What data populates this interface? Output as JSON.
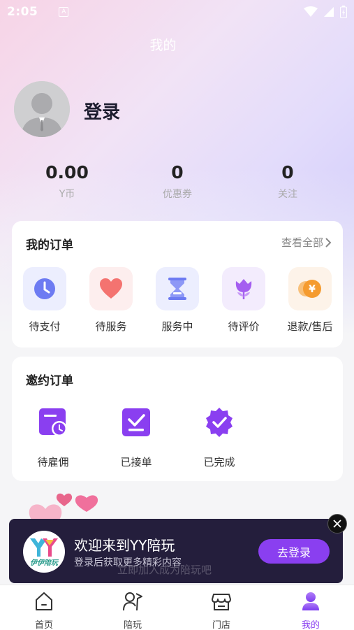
{
  "status_bar": {
    "time": "2:05",
    "a_label": "A"
  },
  "header": {
    "title": "我的"
  },
  "profile": {
    "login_label": "登录"
  },
  "stats": [
    {
      "value": "0.00",
      "label": "Y币"
    },
    {
      "value": "0",
      "label": "优惠券"
    },
    {
      "value": "0",
      "label": "关注"
    }
  ],
  "my_orders": {
    "title": "我的订单",
    "view_all": "查看全部",
    "items": [
      {
        "label": "待支付",
        "icon": "clock-icon",
        "tile_color": "#eceefe"
      },
      {
        "label": "待服务",
        "icon": "heart-icon",
        "tile_color": "#fdeeee"
      },
      {
        "label": "服务中",
        "icon": "hourglass-icon",
        "tile_color": "#eceefe"
      },
      {
        "label": "待评价",
        "icon": "flower-icon",
        "tile_color": "#f3ecfd"
      },
      {
        "label": "退款/售后",
        "icon": "yuan-coin-icon",
        "tile_color": "#fdf3e9",
        "coin_text": "¥"
      }
    ]
  },
  "invite_orders": {
    "title": "邀约订单",
    "items": [
      {
        "label": "待雇佣",
        "icon": "calendar-clock-icon"
      },
      {
        "label": "已接单",
        "icon": "check-box-icon"
      },
      {
        "label": "已完成",
        "icon": "verified-badge-icon"
      }
    ]
  },
  "banner": {
    "title": "欢迎来到YY陪玩",
    "subtitle": "登录后获取更多精彩内容",
    "button": "去登录",
    "logo_text": "伊伊陪玩",
    "ghost_text": "立即加入成为陪玩吧"
  },
  "tabbar": [
    {
      "label": "首页",
      "icon": "home-icon"
    },
    {
      "label": "陪玩",
      "icon": "companion-icon"
    },
    {
      "label": "门店",
      "icon": "store-icon"
    },
    {
      "label": "我的",
      "icon": "profile-icon",
      "active": true
    }
  ],
  "colors": {
    "accent": "#8a3ff0",
    "banner_bg": "#241e3c"
  }
}
